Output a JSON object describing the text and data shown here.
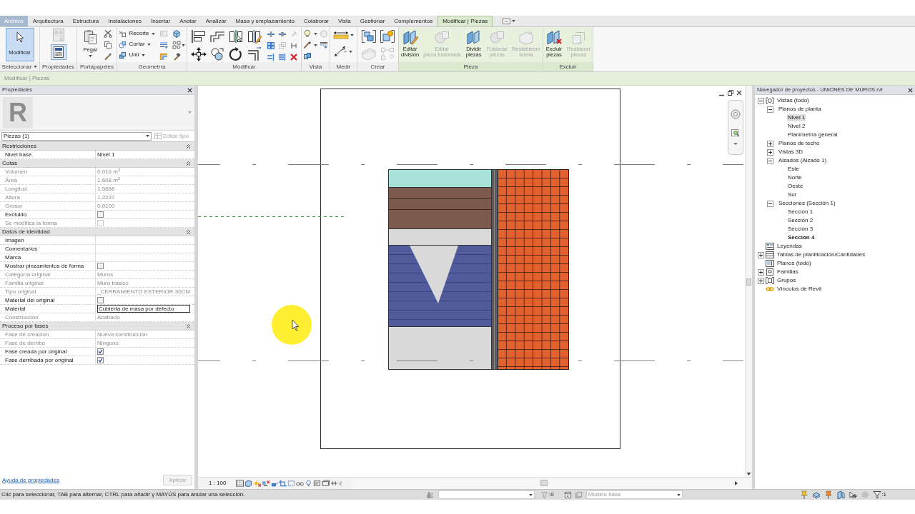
{
  "ribbon": {
    "tabs": [
      {
        "label": "Archivo",
        "kind": "file",
        "selected": false
      },
      {
        "label": "Arquitectura",
        "kind": "tab",
        "selected": false
      },
      {
        "label": "Estructura",
        "kind": "tab",
        "selected": false
      },
      {
        "label": "Instalaciones",
        "kind": "tab",
        "selected": false
      },
      {
        "label": "Insertar",
        "kind": "tab",
        "selected": false
      },
      {
        "label": "Anotar",
        "kind": "tab",
        "selected": false
      },
      {
        "label": "Analizar",
        "kind": "tab",
        "selected": false
      },
      {
        "label": "Masa y emplazamiento",
        "kind": "tab",
        "selected": false
      },
      {
        "label": "Colaborar",
        "kind": "tab",
        "selected": false
      },
      {
        "label": "Vista",
        "kind": "tab",
        "selected": false
      },
      {
        "label": "Gestionar",
        "kind": "tab",
        "selected": false
      },
      {
        "label": "Complementos",
        "kind": "tab",
        "selected": false
      },
      {
        "label": "Modificar | Piezas",
        "kind": "context",
        "selected": true
      }
    ],
    "panels": [
      {
        "kind": "select",
        "title": "Seleccionar",
        "menu": true,
        "contextual": false,
        "tools": [
          {
            "label": "Modificar",
            "selected": true,
            "disabled": false
          }
        ]
      },
      {
        "kind": "properties",
        "title": "Propiedades",
        "menu": false,
        "contextual": false
      },
      {
        "kind": "clipboard",
        "title": "Portapapeles",
        "menu": false,
        "contextual": false,
        "tools": [
          {
            "label": "Pegar",
            "selected": false,
            "disabled": false,
            "dropdown": true
          }
        ]
      },
      {
        "kind": "geometry",
        "title": "Geometría",
        "menu": false,
        "contextual": false,
        "tools": [
          {
            "label": "Recorte",
            "dropdown": true
          },
          {
            "label": "Cortar",
            "dropdown": true
          },
          {
            "label": "Unir",
            "dropdown": true
          }
        ]
      },
      {
        "kind": "modify",
        "title": "Modificar",
        "menu": false,
        "contextual": false
      },
      {
        "kind": "view",
        "title": "Vista",
        "menu": false,
        "contextual": false
      },
      {
        "kind": "measure",
        "title": "Medir",
        "menu": false,
        "contextual": false
      },
      {
        "kind": "create",
        "title": "Crear",
        "menu": false,
        "contextual": false
      },
      {
        "kind": "part",
        "title": "Pieza",
        "menu": false,
        "contextual": true,
        "tools": [
          {
            "label": "Editar\ndivisión",
            "selected": false,
            "disabled": false
          },
          {
            "label": "Editar\npieza fusionada",
            "selected": false,
            "disabled": true
          },
          {
            "label": "Dividir\npiezas",
            "selected": false,
            "disabled": false
          },
          {
            "label": "Fusionar\npiezas",
            "selected": false,
            "disabled": true
          },
          {
            "label": "Restablecer\nforma",
            "selected": false,
            "disabled": true
          }
        ]
      },
      {
        "kind": "exclude",
        "title": "Excluir",
        "menu": false,
        "contextual": true,
        "tools": [
          {
            "label": "Excluir\npiezas",
            "selected": false,
            "disabled": false
          },
          {
            "label": "Restaurar\npiezas",
            "selected": false,
            "disabled": true
          }
        ]
      }
    ]
  },
  "options_bar": {
    "context": "Modificar | Piezas"
  },
  "properties": {
    "title": "Propiedades",
    "type_selector": {
      "logo": "R",
      "type": "Piezas (1)",
      "edit_type": {
        "label": "Editar tipo",
        "disabled": true
      }
    },
    "groups": [
      {
        "title": "Restricciones",
        "expanded": true,
        "rows": [
          {
            "label": "Nivel base",
            "kind": "text",
            "value": "Nivel 1",
            "disabled": false
          }
        ]
      },
      {
        "title": "Cotas",
        "expanded": true,
        "rows": [
          {
            "label": "Volumen",
            "kind": "text",
            "value": "0.016 m$^{3}$",
            "disabled": true
          },
          {
            "label": "Área",
            "kind": "text",
            "value": "1.608 m$^{2}$",
            "disabled": true
          },
          {
            "label": "Longitud",
            "kind": "text",
            "value": "1.5888",
            "disabled": true
          },
          {
            "label": "Altura",
            "kind": "text",
            "value": "1.2237",
            "disabled": true
          },
          {
            "label": "Grosor",
            "kind": "text",
            "value": "0.0100",
            "disabled": true
          },
          {
            "label": "Excluido",
            "kind": "check",
            "checked": false,
            "disabled": false
          },
          {
            "label": "Se modifica la forma",
            "kind": "check",
            "checked": false,
            "disabled": true
          }
        ]
      },
      {
        "title": "Datos de identidad",
        "expanded": true,
        "rows": [
          {
            "label": "Imagen",
            "kind": "text",
            "disabled": false
          },
          {
            "label": "Comentarios",
            "kind": "text",
            "disabled": false
          },
          {
            "label": "Marca",
            "kind": "text",
            "disabled": false
          },
          {
            "label": "Mostrar pinzamientos de forma",
            "kind": "check",
            "checked": false,
            "disabled": false
          },
          {
            "label": "Categoría original",
            "kind": "text",
            "value": "Muros",
            "disabled": true
          },
          {
            "label": "Familia original",
            "kind": "text",
            "value": "Muro básico",
            "disabled": true
          },
          {
            "label": "Tipo original",
            "kind": "text",
            "value": "_CERRAMIENTO EXTERIOR 30CM",
            "disabled": true
          },
          {
            "label": "Material del original",
            "kind": "check",
            "checked": false,
            "disabled": false
          },
          {
            "label": "Material",
            "kind": "field",
            "value": "Cubierta de masa por defecto",
            "disabled": false
          },
          {
            "label": "Construcción",
            "kind": "text",
            "value": "Acabado",
            "disabled": true
          }
        ]
      },
      {
        "title": "Proceso por fases",
        "expanded": true,
        "rows": [
          {
            "label": "Fase de creación",
            "kind": "text",
            "value": "Nueva construcción",
            "disabled": true
          },
          {
            "label": "Fase de derribo",
            "kind": "text",
            "value": "Ninguno",
            "disabled": true
          },
          {
            "label": "Fase creada por original",
            "kind": "check",
            "checked": true,
            "disabled": false
          },
          {
            "label": "Fase derribada por original",
            "kind": "check",
            "checked": true,
            "disabled": false
          }
        ]
      }
    ],
    "help_link": "Ayuda de propiedades",
    "apply": {
      "label": "Aplicar",
      "disabled": true
    }
  },
  "view": {
    "scale": "1 : 100"
  },
  "project_browser": {
    "title": "Navegador de proyectos - UNIONES DE MUROS.rvt",
    "tree": [
      {
        "label": "Vistas (todo)",
        "kind": "views",
        "expanded": true,
        "selected": false,
        "children": [
          {
            "label": "Planos de planta",
            "expanded": true,
            "selected": false,
            "children": [
              {
                "label": "Nivel 1",
                "selected": true,
                "current": false
              },
              {
                "label": "Nivel 2",
                "selected": false,
                "current": false
              },
              {
                "label": "Planimetría general",
                "selected": false,
                "current": false
              }
            ]
          },
          {
            "label": "Planos de techo",
            "expanded": false,
            "selected": false
          },
          {
            "label": "Vistas 3D",
            "expanded": false,
            "selected": false
          },
          {
            "label": "Alzados (Alzado 1)",
            "expanded": true,
            "selected": false,
            "children": [
              {
                "label": "Este",
                "selected": false,
                "current": false
              },
              {
                "label": "Norte",
                "selected": false,
                "current": false
              },
              {
                "label": "Oeste",
                "selected": false,
                "current": false
              },
              {
                "label": "Sur",
                "selected": false,
                "current": false
              }
            ]
          },
          {
            "label": "Secciones (Sección 1)",
            "expanded": true,
            "selected": false,
            "children": [
              {
                "label": "Sección 1",
                "selected": false,
                "current": false
              },
              {
                "label": "Sección 2",
                "selected": false,
                "current": false
              },
              {
                "label": "Sección 3",
                "selected": false,
                "current": false
              },
              {
                "label": "Sección 4",
                "selected": false,
                "current": true
              }
            ]
          }
        ]
      },
      {
        "label": "Leyendas",
        "kind": "legends",
        "selected": false
      },
      {
        "label": "Tablas de planificación/Cantidades",
        "kind": "schedules",
        "expanded": false,
        "selected": false
      },
      {
        "label": "Planos (todo)",
        "kind": "sheets",
        "selected": false
      },
      {
        "label": "Familias",
        "kind": "families",
        "expanded": false,
        "selected": false
      },
      {
        "label": "Grupos",
        "kind": "groups",
        "expanded": false,
        "selected": false
      },
      {
        "label": "Vínculos de Revit",
        "kind": "links",
        "selected": false
      }
    ]
  },
  "status_bar": {
    "message": "Clic para seleccionar, TAB para alternar, CTRL para añadir y MAYÚS para anular una selección.",
    "selection_count": ":0",
    "model": {
      "value": "Modelo base",
      "disabled": true
    },
    "filter_count": ":1"
  }
}
